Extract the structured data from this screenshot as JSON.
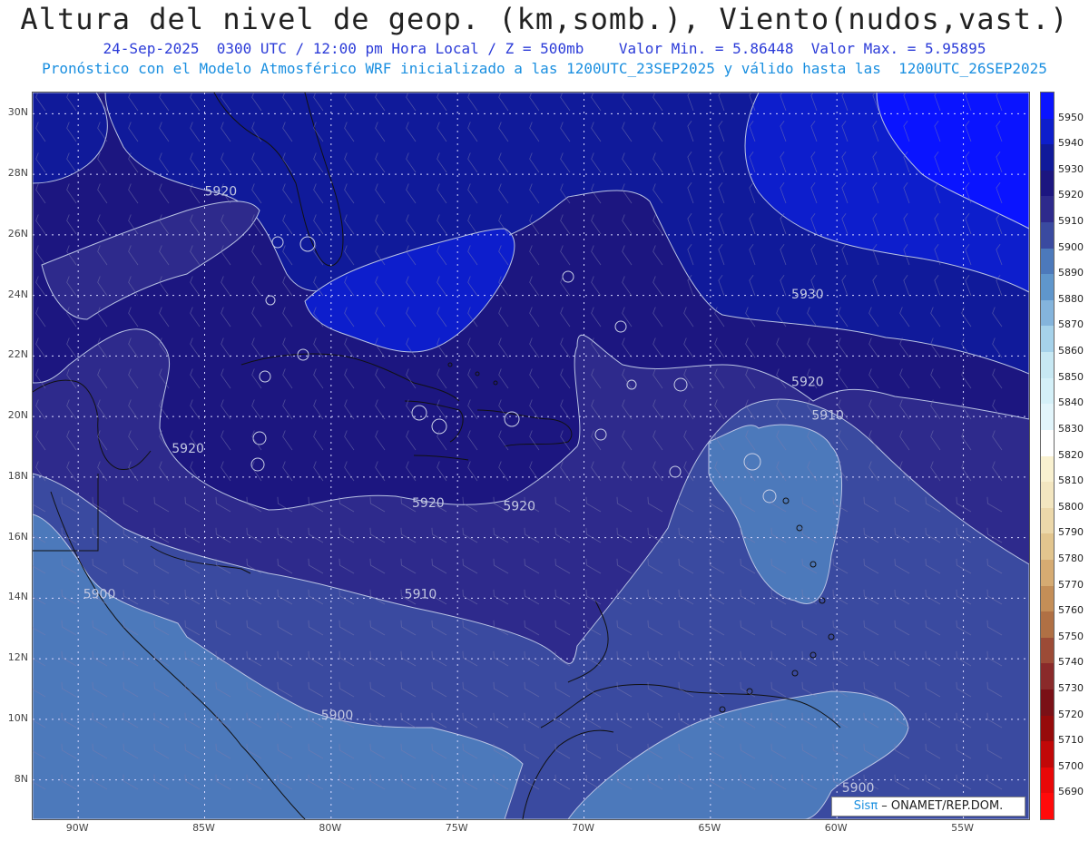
{
  "header": {
    "title": "Altura del nivel de geop. (km,somb.), Viento(nudos,vast.)",
    "subtitle1": "24-Sep-2025  0300 UTC / 12:00 pm Hora Local / Z = 500mb    Valor Min. = 5.86448  Valor Max. = 5.95895",
    "subtitle2": "Pronóstico con el Modelo Atmosférico WRF inicializado a las 1200UTC_23SEP2025 y válido hasta las  1200UTC_26SEP2025"
  },
  "map": {
    "lat_labels": [
      "30N",
      "28N",
      "26N",
      "24N",
      "22N",
      "20N",
      "18N",
      "16N",
      "14N",
      "12N",
      "10N",
      "8N"
    ],
    "lat_values": [
      30,
      28,
      26,
      24,
      22,
      20,
      18,
      16,
      14,
      12,
      10,
      8
    ],
    "lon_labels": [
      "90W",
      "85W",
      "80W",
      "75W",
      "70W",
      "65W",
      "60W",
      "55W"
    ],
    "lon_values": [
      -90,
      -85,
      -80,
      -75,
      -70,
      -65,
      -60,
      -55
    ],
    "extent": {
      "lon_min": -91.8,
      "lon_max": -52.4,
      "lat_min": 6.7,
      "lat_max": 30.7
    },
    "contour_labels": [
      {
        "text": "5920",
        "lon": -85.0,
        "lat": 27.3
      },
      {
        "text": "5930",
        "lon": -61.8,
        "lat": 23.9
      },
      {
        "text": "5920",
        "lon": -61.8,
        "lat": 21.0
      },
      {
        "text": "5910",
        "lon": -61.0,
        "lat": 19.9
      },
      {
        "text": "5920",
        "lon": -86.3,
        "lat": 18.8
      },
      {
        "text": "5920",
        "lon": -76.8,
        "lat": 17.0
      },
      {
        "text": "5920",
        "lon": -73.2,
        "lat": 16.9
      },
      {
        "text": "5910",
        "lon": -77.1,
        "lat": 14.0
      },
      {
        "text": "5900",
        "lon": -89.8,
        "lat": 14.0
      },
      {
        "text": "5900",
        "lon": -80.4,
        "lat": 10.0
      },
      {
        "text": "5900",
        "lon": -59.8,
        "lat": 7.6
      }
    ]
  },
  "colorbar": {
    "levels": [
      "5950",
      "5940",
      "5930",
      "5920",
      "5910",
      "5900",
      "5890",
      "5880",
      "5870",
      "5860",
      "5850",
      "5840",
      "5830",
      "5820",
      "5810",
      "5800",
      "5790",
      "5780",
      "5770",
      "5760",
      "5750",
      "5740",
      "5730",
      "5720",
      "5710",
      "5700",
      "5690"
    ],
    "colors": [
      "#0a14ff",
      "#0d1ecc",
      "#101a9a",
      "#1c1680",
      "#2e2a8c",
      "#3a4aa0",
      "#4c79bb",
      "#5f96cc",
      "#84b4dc",
      "#a6d2ea",
      "#c7e8f3",
      "#d4f0f8",
      "#e2f5fb",
      "#ffffff",
      "#f9f1d0",
      "#f3e6c0",
      "#ecd8aa",
      "#e2c58e",
      "#d6ab72",
      "#c48e57",
      "#b07044",
      "#9c4b36",
      "#8a2a2a",
      "#7a1016",
      "#960a0a",
      "#c10808",
      "#e80808",
      "#ff0a0a"
    ]
  },
  "credit": {
    "logo": "Sisπ",
    "text": " – ONAMET/REP.DOM."
  }
}
